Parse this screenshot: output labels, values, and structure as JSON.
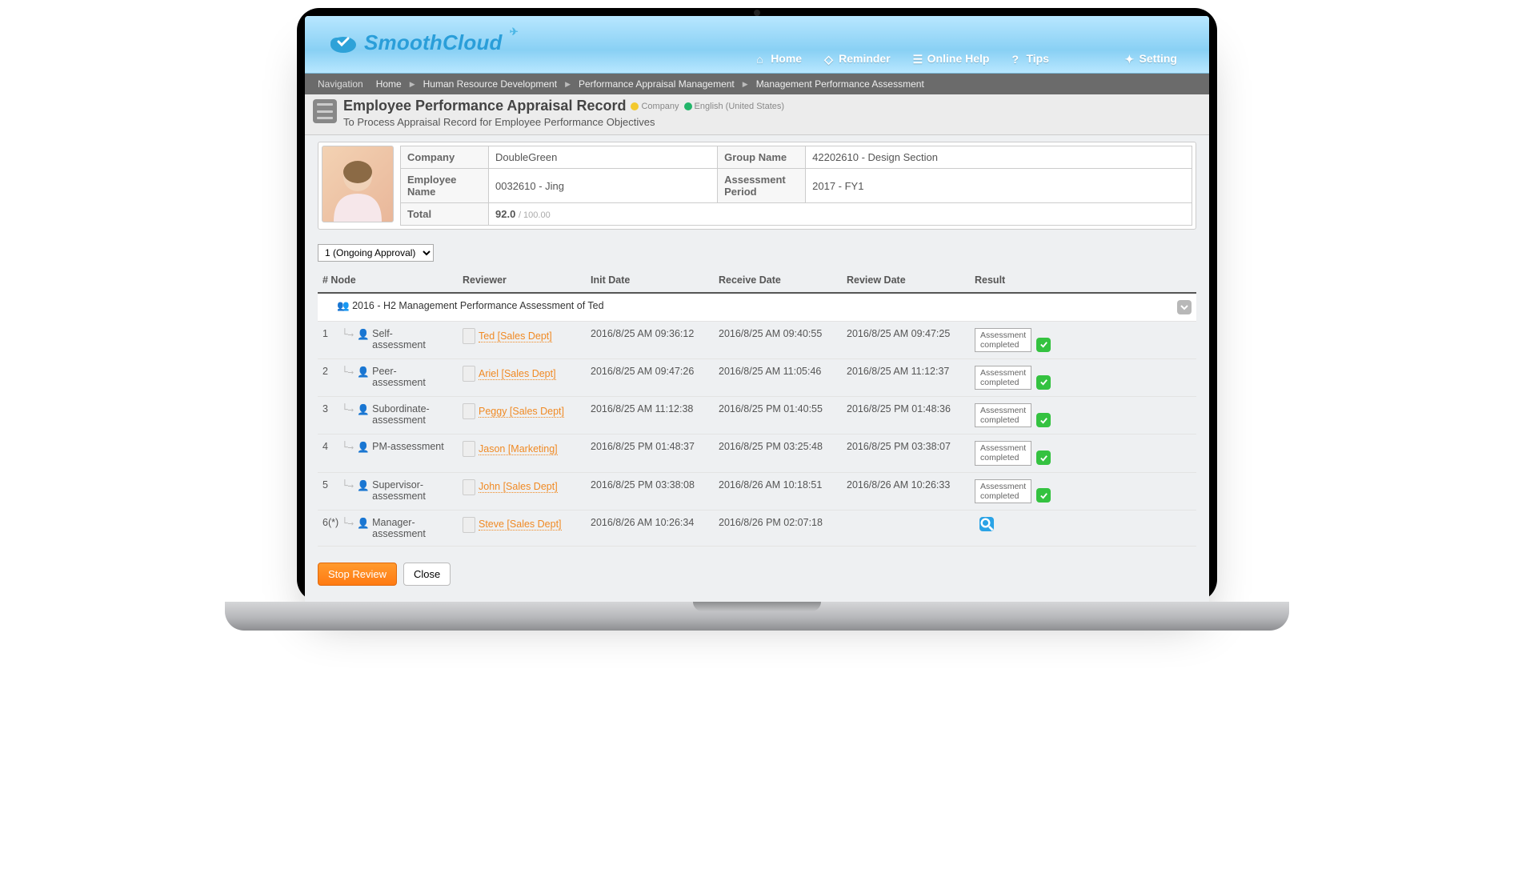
{
  "brand": "SmoothCloud",
  "nav": {
    "home": "Home",
    "reminder": "Reminder",
    "help": "Online Help",
    "tips": "Tips",
    "setting": "Setting"
  },
  "breadcrumb": {
    "label": "Navigation",
    "items": [
      "Home",
      "Human Resource Development",
      "Performance Appraisal Management",
      "Management Performance Assessment"
    ]
  },
  "page": {
    "title": "Employee Performance Appraisal Record",
    "subtitle": "To Process Appraisal Record for Employee Performance Objectives",
    "badge_company": "Company",
    "badge_lang": "English (United States)"
  },
  "info": {
    "company_label": "Company",
    "company": "DoubleGreen",
    "group_label": "Group Name",
    "group": "42202610 - Design Section",
    "emp_label": "Employee Name",
    "emp": "0032610 - Jing",
    "period_label": "Assessment Period",
    "period": "2017 - FY1",
    "total_label": "Total",
    "total": "92.0",
    "total_max": "/ 100.00"
  },
  "approval_selected": "1 (Ongoing Approval)",
  "table": {
    "headers": {
      "node": "# Node",
      "reviewer": "Reviewer",
      "init": "Init Date",
      "receive": "Receive Date",
      "review": "Review Date",
      "result": "Result"
    },
    "group_title": "2016 - H2 Management Performance Assessment of Ted",
    "result_label": "Assessment completed",
    "rows": [
      {
        "idx": "1",
        "node": "Self-assessment",
        "reviewer": "Ted [Sales Dept]",
        "init": "2016/8/25 AM 09:36:12",
        "receive": "2016/8/25 AM 09:40:55",
        "review": "2016/8/25 AM 09:47:25",
        "done": true,
        "pending": false
      },
      {
        "idx": "2",
        "node": "Peer-assessment",
        "reviewer": "Ariel [Sales Dept]",
        "init": "2016/8/25 AM 09:47:26",
        "receive": "2016/8/25 AM 11:05:46",
        "review": "2016/8/25 AM 11:12:37",
        "done": true,
        "pending": false
      },
      {
        "idx": "3",
        "node": "Subordinate-assessment",
        "reviewer": "Peggy [Sales Dept]",
        "init": "2016/8/25 AM 11:12:38",
        "receive": "2016/8/25 PM 01:40:55",
        "review": "2016/8/25 PM 01:48:36",
        "done": true,
        "pending": false
      },
      {
        "idx": "4",
        "node": "PM-assessment",
        "reviewer": "Jason [Marketing]",
        "init": "2016/8/25 PM 01:48:37",
        "receive": "2016/8/25 PM 03:25:48",
        "review": "2016/8/25 PM 03:38:07",
        "done": true,
        "pending": false
      },
      {
        "idx": "5",
        "node": "Supervisor-assessment",
        "reviewer": "John [Sales Dept]",
        "init": "2016/8/25 PM 03:38:08",
        "receive": "2016/8/26 AM 10:18:51",
        "review": "2016/8/26 AM 10:26:33",
        "done": true,
        "pending": false
      },
      {
        "idx": "6(*)",
        "node": "Manager-assessment",
        "reviewer": "Steve [Sales Dept]",
        "init": "2016/8/26 AM 10:26:34",
        "receive": "2016/8/26 PM 02:07:18",
        "review": "",
        "done": false,
        "pending": true
      }
    ]
  },
  "actions": {
    "stop": "Stop Review",
    "close": "Close"
  }
}
